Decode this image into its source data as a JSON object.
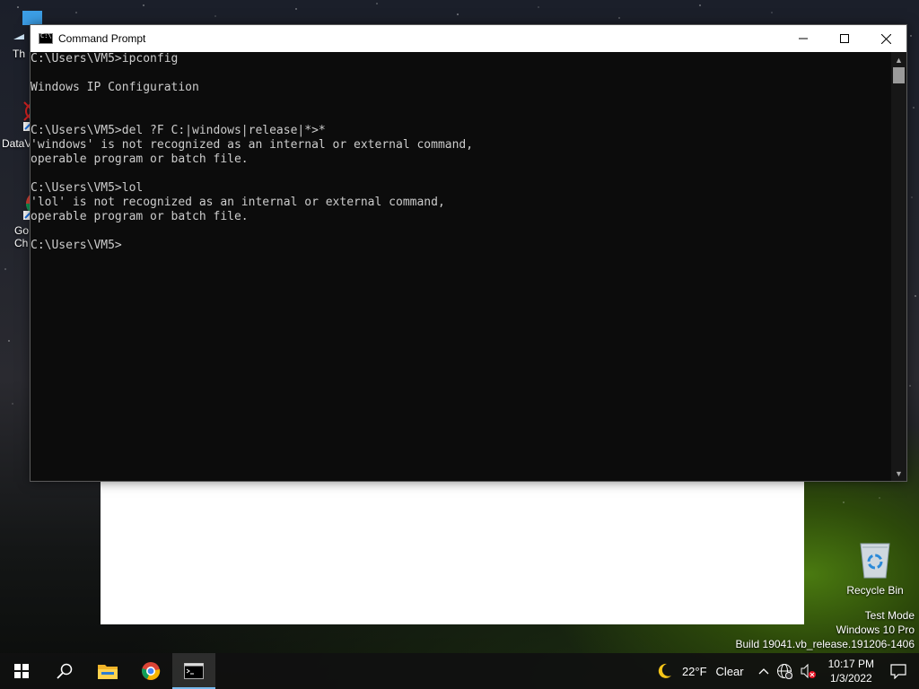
{
  "desktop": {
    "icons": [
      {
        "label": "Th",
        "icon": "this-pc-icon"
      },
      {
        "label": "DataV",
        "icon": "datav-app-icon"
      },
      {
        "label": "Go",
        "label2": "Ch",
        "icon": "google-chrome-icon"
      }
    ],
    "recycle_bin": {
      "label": "Recycle Bin",
      "icon": "recycle-bin-icon"
    }
  },
  "cmd_window": {
    "title": "Command Prompt",
    "lines": [
      "C:\\Users\\VM5>ipconfig",
      "",
      "Windows IP Configuration",
      "",
      "",
      "C:\\Users\\VM5>del ?F C:|windows|release|*>*",
      "'windows' is not recognized as an internal or external command,",
      "operable program or batch file.",
      "",
      "C:\\Users\\VM5>lol",
      "'lol' is not recognized as an internal or external command,",
      "operable program or batch file.",
      "",
      "C:\\Users\\VM5>"
    ],
    "text_color": "#cccccc",
    "background": "#0c0c0c"
  },
  "watermark": {
    "line1": "Test Mode",
    "line2": "Windows 10 Pro",
    "line3": "Build 19041.vb_release.191206-1406"
  },
  "taskbar": {
    "weather_temp": "22°F",
    "weather_desc": "Clear",
    "time": "10:17 PM",
    "date": "1/3/2022",
    "accent": "#76b9ed"
  }
}
